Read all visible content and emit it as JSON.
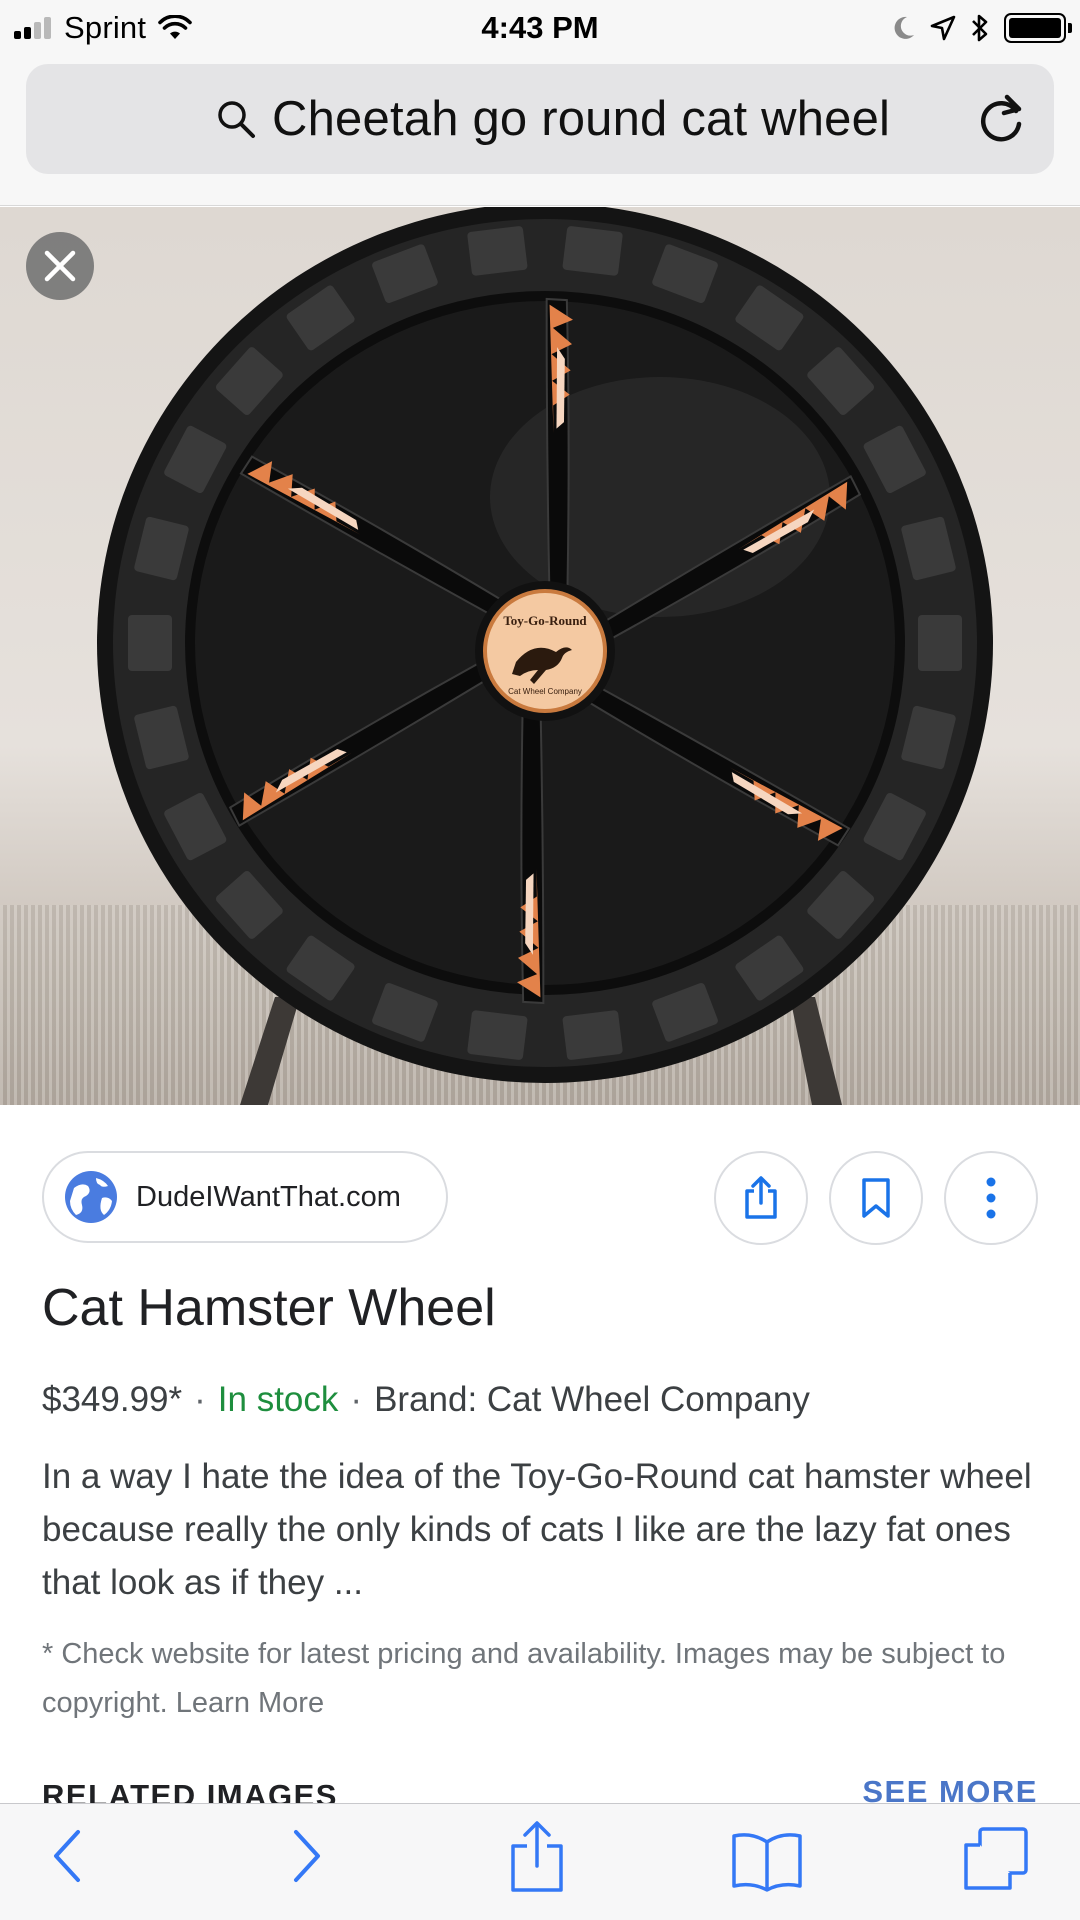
{
  "status_bar": {
    "carrier": "Sprint",
    "time": "4:43 PM"
  },
  "search": {
    "query": "Cheetah go round cat wheel"
  },
  "hero": {
    "logo_text": "Toy-Go-Round",
    "logo_subtext": "Cat Wheel Company"
  },
  "result": {
    "source": "DudeIWantThat.com",
    "title": "Cat Hamster Wheel",
    "price": "$349.99*",
    "stock": "In stock",
    "brand": "Brand: Cat Wheel Company",
    "description": "In a way I hate the idea of the Toy-Go-Round cat hamster wheel because really the only kinds of cats I like are the lazy fat ones that look as if they ...",
    "disclaimer": "* Check website for latest pricing and availability. Images may be subject to copyright. Learn More",
    "related_heading": "RELATED IMAGES",
    "see_more": "SEE MORE"
  },
  "colors": {
    "link_blue": "#4a76c8",
    "stock_green": "#1e8e3e",
    "ios_blue": "#3478f6"
  },
  "toolbar": {
    "icons": [
      "back-icon",
      "forward-icon",
      "share-icon",
      "bookmarks-icon",
      "tabs-icon"
    ]
  }
}
